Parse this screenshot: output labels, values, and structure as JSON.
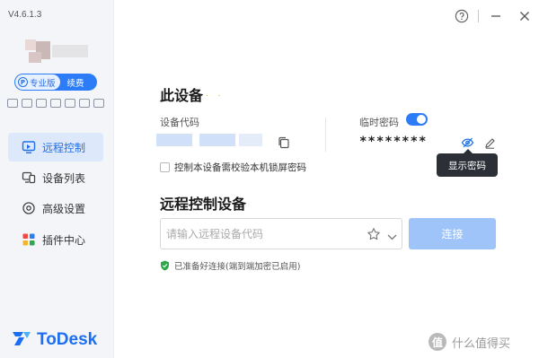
{
  "app": {
    "version": "V4.6.1.3",
    "brand_name": "ToDesk",
    "plan": {
      "pro_label": "专业版",
      "renew_label": "续费"
    }
  },
  "sidebar": {
    "items": [
      {
        "label": "远程控制",
        "icon": "remote-control-icon",
        "active": true
      },
      {
        "label": "设备列表",
        "icon": "device-list-icon",
        "active": false
      },
      {
        "label": "高级设置",
        "icon": "settings-icon",
        "active": false
      },
      {
        "label": "插件中心",
        "icon": "plugin-center-icon",
        "active": false
      }
    ]
  },
  "this_device": {
    "title": "此设备",
    "code_label": "设备代码",
    "password_label": "临时密码",
    "password_value": "********",
    "password_toggle_on": true,
    "tooltip": "显示密码",
    "lock_checkbox_label": "控制本设备需校验本机锁屏密码",
    "lock_checkbox_checked": false
  },
  "remote": {
    "title": "远程控制设备",
    "input_placeholder": "请输入远程设备代码",
    "connect_label": "连接",
    "status_text": "已准备好连接(端到端加密已启用)"
  },
  "watermark": {
    "text": "什么值得买",
    "badge": "值"
  },
  "colors": {
    "accent": "#2b7cf6",
    "nav_active_bg": "#dde9fb",
    "connect_disabled": "#9fc4f9",
    "status_ok": "#2ea84a",
    "tooltip_bg": "#2c2f36"
  }
}
